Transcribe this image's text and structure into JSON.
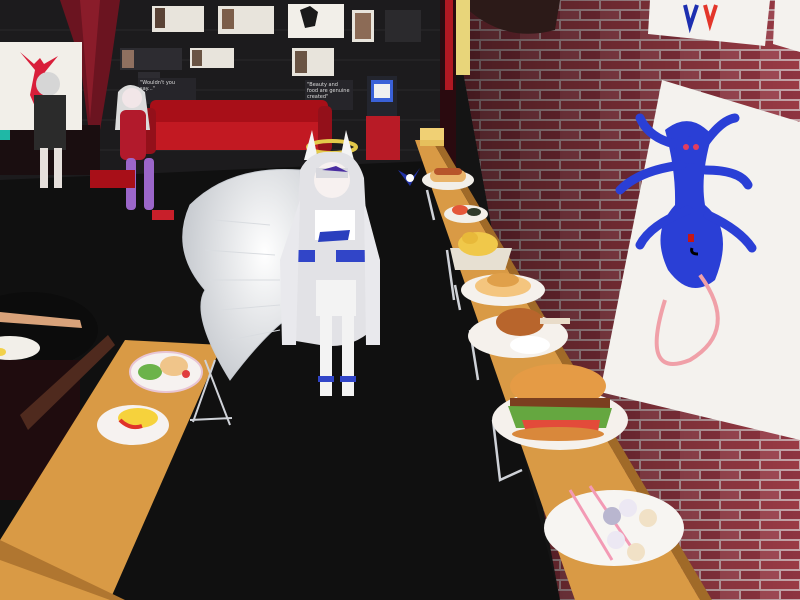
{
  "scene": {
    "title": "",
    "type": "virtual-world-first-person-view",
    "wall_notes": [
      {
        "id": "note-a",
        "text": "\"Wouldn't you\nsay...\""
      },
      {
        "id": "note-b",
        "text": "\"Beauty and\nfood are genuine\ncreated\""
      }
    ],
    "colors": {
      "brick_wall": "#9a3b45",
      "table_top": "#d99a45",
      "sofa": "#b5121b",
      "floor": "#141414",
      "poster_figure": "#2a3fd6"
    }
  },
  "food_items": [
    {
      "id": "salad-plate",
      "icon": "salad"
    },
    {
      "id": "omelette-plate",
      "icon": "omelette"
    },
    {
      "id": "cake-slice",
      "icon": "cake"
    },
    {
      "id": "hotdog-plate",
      "icon": "hotdog"
    },
    {
      "id": "sushi-plate",
      "icon": "sushi"
    },
    {
      "id": "fries-plate",
      "icon": "fries"
    },
    {
      "id": "pudding-plate",
      "icon": "pudding"
    },
    {
      "id": "chicken-plate",
      "icon": "chicken-leg"
    },
    {
      "id": "burger-plate",
      "icon": "burger"
    },
    {
      "id": "mouse-dango-plate",
      "icon": "mouse-dango"
    }
  ]
}
